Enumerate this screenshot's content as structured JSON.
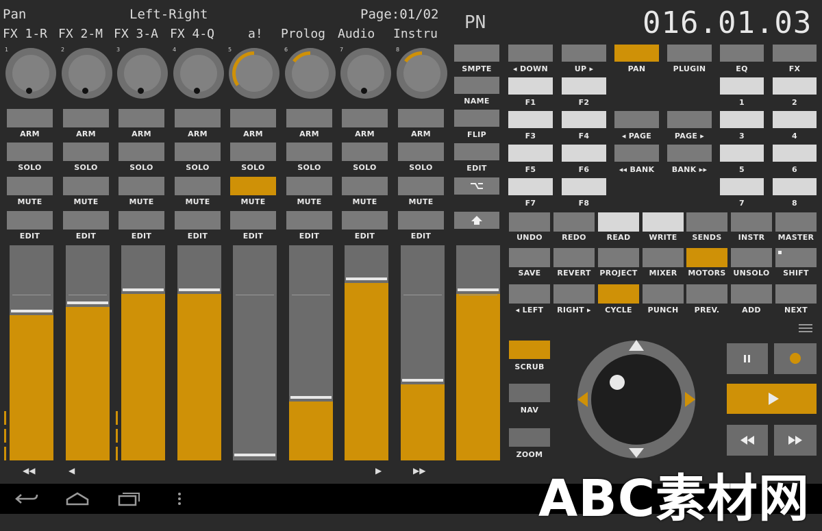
{
  "header": {
    "param_name": "Pan",
    "param_mode": "Left-Right",
    "page": "Page:01/02",
    "display_mode": "PN",
    "timecode": "016.01.03"
  },
  "channels": [
    {
      "name": "FX 1-R",
      "num": "1",
      "knob_value": 0.0,
      "fader_level": 0.7,
      "mute_lit": false
    },
    {
      "name": "FX 2-M",
      "num": "2",
      "knob_value": 0.0,
      "fader_level": 0.74,
      "mute_lit": false
    },
    {
      "name": "FX 3-A",
      "num": "3",
      "knob_value": 0.0,
      "fader_level": 0.8,
      "mute_lit": false
    },
    {
      "name": "FX 4-Q",
      "num": "4",
      "knob_value": 0.0,
      "fader_level": 0.8,
      "mute_lit": false
    },
    {
      "name": "a!",
      "num": "5",
      "knob_value": 0.35,
      "fader_level": 0.0,
      "mute_lit": true
    },
    {
      "name": "Prolog",
      "num": "6",
      "knob_value": 0.15,
      "fader_level": 0.3,
      "mute_lit": false
    },
    {
      "name": "Audio",
      "num": "7",
      "knob_value": 0.0,
      "fader_level": 0.85,
      "mute_lit": false
    },
    {
      "name": "Instru",
      "num": "8",
      "knob_value": 0.15,
      "fader_level": 0.38,
      "mute_lit": false
    }
  ],
  "strip_labels": {
    "arm": "ARM",
    "solo": "SOLO",
    "mute": "MUTE",
    "edit": "EDIT"
  },
  "master_fader_level": 0.8,
  "bank_nav": {
    "far_left": "◀◀",
    "left": "◀",
    "right": "▶",
    "far_right": "▶▶"
  },
  "middle_column": {
    "smpte": "SMPTE",
    "name": "NAME",
    "flip": "FLIP",
    "edit": "EDIT",
    "option_icon": "option-key-icon",
    "shift_icon": "shift-arrow-icon"
  },
  "function_grid": {
    "down": "◂ DOWN",
    "up": "UP ▸",
    "pan": "PAN",
    "plugin": "PLUGIN",
    "eq": "EQ",
    "fx": "FX",
    "f1": "F1",
    "f2": "F2",
    "f3": "F3",
    "f4": "F4",
    "f5": "F5",
    "f6": "F6",
    "f7": "F7",
    "f8": "F8",
    "page_left": "◂ PAGE",
    "page_right": "PAGE ▸",
    "bank_left": "◂◂ BANK",
    "bank_right": "BANK ▸▸",
    "n1": "1",
    "n2": "2",
    "n3": "3",
    "n4": "4",
    "n5": "5",
    "n6": "6",
    "n7": "7",
    "n8": "8"
  },
  "transport_grid": {
    "row1": [
      "UNDO",
      "REDO",
      "READ",
      "WRITE",
      "SENDS",
      "INSTR",
      "MASTER"
    ],
    "row2": [
      "SAVE",
      "REVERT",
      "PROJECT",
      "MIXER",
      "MOTORS",
      "UNSOLO",
      "SHIFT"
    ],
    "row3": [
      "◂ LEFT",
      "RIGHT ▸",
      "CYCLE",
      "PUNCH",
      "PREV.",
      "ADD",
      "NEXT"
    ]
  },
  "jog_modes": {
    "scrub": "SCRUB",
    "nav": "NAV",
    "zoom": "ZOOM"
  },
  "transport_icons": {
    "pause": "pause-icon",
    "record": "record-icon",
    "play": "play-icon",
    "rewind": "rewind-icon",
    "fast_forward": "fast-forward-icon",
    "menu": "menu-icon"
  },
  "android_nav": {
    "back": "back-icon",
    "home": "home-icon",
    "recents": "recents-icon",
    "overflow": "overflow-icon"
  },
  "watermark": "ABC素材网",
  "colors": {
    "accent": "#cf9107",
    "button": "#7a7a7a",
    "background": "#2a2a2a"
  }
}
